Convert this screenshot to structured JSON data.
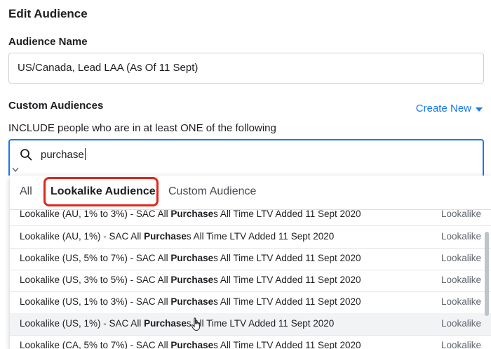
{
  "header": {
    "title": "Edit Audience"
  },
  "audience_name": {
    "label": "Audience Name",
    "value": "US/Canada, Lead LAA (As Of 11 Sept)"
  },
  "custom_audiences": {
    "label": "Custom Audiences",
    "create_new": "Create New",
    "include_text": "INCLUDE people who are in at least ONE of the following",
    "search_value": "purchase"
  },
  "tabs": [
    {
      "label": "All"
    },
    {
      "label": "Lookalike Audience"
    },
    {
      "label": "Custom Audience"
    }
  ],
  "rows": [
    {
      "prefix": "Lookalike (AU, 1% to 3%) - SAC All ",
      "bold": "Purchase",
      "suffix": "s All Time LTV Added 11 Sept 2020",
      "type": "Lookalike"
    },
    {
      "prefix": "Lookalike (AU, 1%) - SAC All ",
      "bold": "Purchase",
      "suffix": "s All Time LTV Added 11 Sept 2020",
      "type": "Lookalike"
    },
    {
      "prefix": "Lookalike (US, 5% to 7%) - SAC All ",
      "bold": "Purchase",
      "suffix": "s All Time LTV Added 11 Sept 2020",
      "type": "Lookalike"
    },
    {
      "prefix": "Lookalike (US, 3% to 5%) - SAC All ",
      "bold": "Purchase",
      "suffix": "s All Time LTV Added 11 Sept 2020",
      "type": "Lookalike"
    },
    {
      "prefix": "Lookalike (US, 1% to 3%) - SAC All ",
      "bold": "Purchase",
      "suffix": "s All Time LTV Added 11 Sept 2020",
      "type": "Lookalike"
    },
    {
      "prefix": "Lookalike (US, 1%) - SAC All ",
      "bold": "Purchase",
      "suffix": "s All Time LTV Added 11 Sept 2020",
      "type": "Lookalike"
    },
    {
      "prefix": "Lookalike (CA, 5% to 7%) - SAC All ",
      "bold": "Purchase",
      "suffix": "s All Time LTV Added 11 Sept 2020",
      "type": "Lookalike"
    }
  ],
  "colors": {
    "accent": "#1877f2",
    "highlight": "#e0261b"
  }
}
